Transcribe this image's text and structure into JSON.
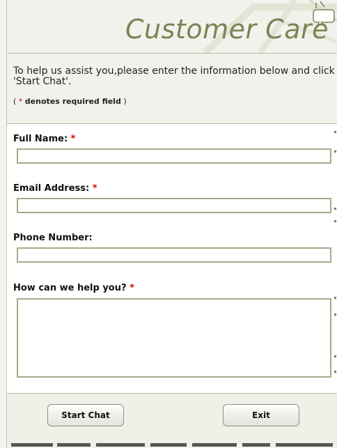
{
  "header": {
    "title": "Customer Care"
  },
  "intro": {
    "text": "To help us assist you,please enter the information below and click 'Start Chat'.",
    "required_open": "( ",
    "required_star": "*",
    "required_label": "denotes required field",
    "required_close": " )"
  },
  "form": {
    "full_name_label": "Full Name:",
    "full_name_star": "*",
    "full_name_value": "",
    "email_label": "Email Address:",
    "email_star": "*",
    "email_value": "",
    "phone_label": "Phone Number:",
    "phone_value": "",
    "help_label": "How can we help you?",
    "help_star": "*",
    "help_value": ""
  },
  "footer": {
    "start_label": "Start Chat",
    "exit_label": "Exit"
  },
  "colors": {
    "title": "#7e8254",
    "required": "#dd0000",
    "input_border": "#a8aa8a",
    "panel": "#f2f2ec"
  },
  "icons": {
    "header_decor": "chat-bubble-graphic"
  }
}
